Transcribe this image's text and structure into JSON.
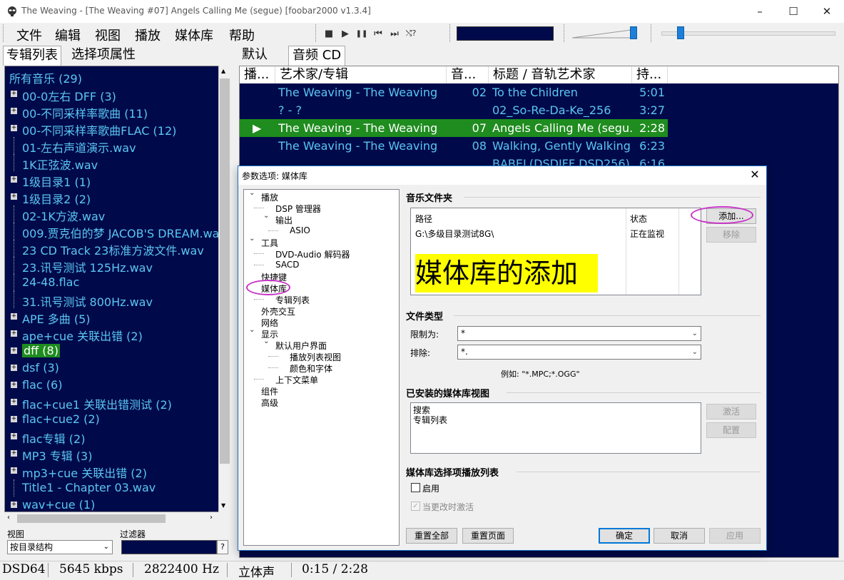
{
  "window": {
    "title": "The Weaving - [The Weaving #07] Angels Calling Me (segue)   [foobar2000 v1.3.4]",
    "minimize": "–",
    "maximize": "☐",
    "close": "✕"
  },
  "menu": [
    "文件",
    "编辑",
    "视图",
    "播放",
    "媒体库",
    "帮助"
  ],
  "toolbar": {
    "stop": "■",
    "play": "▶",
    "pause": "❚❚",
    "prev": "⏮",
    "next": "⏭",
    "random": "⤭?"
  },
  "volume_level": 0.95,
  "seek_position": 0.11,
  "left_tabs": [
    "专辑列表",
    "选择项属性"
  ],
  "album_tree": {
    "root": "所有音乐 (29)",
    "items": [
      {
        "label": "00-0左右 DFF (3)",
        "expand": true
      },
      {
        "label": "00-不同采样率歌曲 (11)",
        "expand": true
      },
      {
        "label": "00-不同采样率歌曲FLAC (12)",
        "expand": true
      },
      {
        "label": "01-左右声道演示.wav",
        "expand": false
      },
      {
        "label": "1K正弦波.wav",
        "expand": false
      },
      {
        "label": "1级目录1 (1)",
        "expand": true
      },
      {
        "label": "1级目录2 (2)",
        "expand": true
      },
      {
        "label": "02-1K方波.wav",
        "expand": false
      },
      {
        "label": "009.贾克伯的梦 JACOB'S DREAM.wav",
        "expand": false
      },
      {
        "label": "23 CD Track 23标准方波文件.wav",
        "expand": false
      },
      {
        "label": "23.讯号测试 125Hz.wav",
        "expand": false
      },
      {
        "label": "24-48.flac",
        "expand": false
      },
      {
        "label": "31.讯号测试 800Hz.wav",
        "expand": false
      },
      {
        "label": "APE 多曲 (5)",
        "expand": true
      },
      {
        "label": "ape+cue 关联出错 (2)",
        "expand": true
      },
      {
        "label": "dff (8)",
        "expand": true,
        "selected": true
      },
      {
        "label": "dsf (3)",
        "expand": true
      },
      {
        "label": "flac (6)",
        "expand": true
      },
      {
        "label": "flac+cue1 关联出错测试 (2)",
        "expand": true
      },
      {
        "label": "flac+cue2 (2)",
        "expand": true
      },
      {
        "label": "flac专辑 (2)",
        "expand": true
      },
      {
        "label": "MP3 专辑 (3)",
        "expand": true
      },
      {
        "label": "mp3+cue 关联出错 (2)",
        "expand": true
      },
      {
        "label": "Title1 - Chapter 03.wav",
        "expand": false
      },
      {
        "label": "wav+cue (1)",
        "expand": true
      }
    ]
  },
  "bottom_left": {
    "view_label": "视图",
    "view_value": "按目录结构",
    "filter_label": "过滤器",
    "help": "?"
  },
  "right_tabs": [
    "默认",
    "音频 CD"
  ],
  "playlist": {
    "columns": [
      "播...",
      "艺术家/专辑",
      "音...",
      "标题 / 音轨艺术家",
      "持..."
    ],
    "rows": [
      {
        "playing": "",
        "artist": "The Weaving - The Weaving",
        "track": "02",
        "title": "To the Children",
        "duration": "5:01"
      },
      {
        "playing": "",
        "artist": "? - ?",
        "track": "",
        "title": "02_So-Re-Da-Ke_256",
        "duration": "3:27"
      },
      {
        "playing": "▶",
        "artist": "The Weaving - The Weaving",
        "track": "07",
        "title": "Angels Calling Me (segu...",
        "duration": "2:28",
        "active": true
      },
      {
        "playing": "",
        "artist": "The Weaving - The Weaving",
        "track": "08",
        "title": "Walking, Gently Walking",
        "duration": "6:23"
      },
      {
        "playing": "",
        "artist": "",
        "track": "",
        "title": "BABEL(DSDIFF DSD256)",
        "duration": "6:16"
      }
    ]
  },
  "status": [
    "DSD64",
    "5645 kbps",
    "2822400 Hz",
    "立体声",
    "0:15 / 2:28"
  ],
  "dialog": {
    "title": "参数选项: 媒体库",
    "close": "✕",
    "tree": [
      {
        "label": "播放",
        "arrow": "⌄"
      },
      {
        "label": "DSP 管理器"
      },
      {
        "label": "输出",
        "arrow": "⌄"
      },
      {
        "label": "ASIO"
      },
      {
        "label": "工具",
        "arrow": "⌄"
      },
      {
        "label": "DVD-Audio 解码器"
      },
      {
        "label": "SACD"
      },
      {
        "label": "快捷键"
      },
      {
        "label": "媒体库"
      },
      {
        "label": "专辑列表"
      },
      {
        "label": "外壳交互"
      },
      {
        "label": "网络"
      },
      {
        "label": "显示",
        "arrow": "⌄"
      },
      {
        "label": "默认用户界面",
        "arrow": "⌄"
      },
      {
        "label": "播放列表视图"
      },
      {
        "label": "颜色和字体"
      },
      {
        "label": "上下文菜单"
      },
      {
        "label": "组件"
      },
      {
        "label": "高级"
      }
    ],
    "music_folders": {
      "title": "音乐文件夹",
      "col_path": "路径",
      "col_status": "状态",
      "path": "G:\\多级目录测试8G\\",
      "status": "正在监视",
      "note": "媒体库的添加",
      "add": "添加...",
      "remove": "移除"
    },
    "file_types": {
      "title": "文件类型",
      "restrict_label": "限制为:",
      "restrict_value": "*",
      "exclude_label": "排除:",
      "exclude_value": "*.",
      "example": "例如: \"*.MPC;*.OGG\""
    },
    "installed_views": {
      "title": "已安装的媒体库视图",
      "items": [
        "搜索",
        "专辑列表"
      ],
      "activate": "激活",
      "configure": "配置"
    },
    "selection_playlist": {
      "title": "媒体库选择项播放列表",
      "enable": "启用",
      "activate_on_change": "当更改时激活"
    },
    "buttons": {
      "reset_all": "重置全部",
      "reset_page": "重置页面",
      "ok": "确定",
      "cancel": "取消",
      "apply": "应用"
    }
  }
}
